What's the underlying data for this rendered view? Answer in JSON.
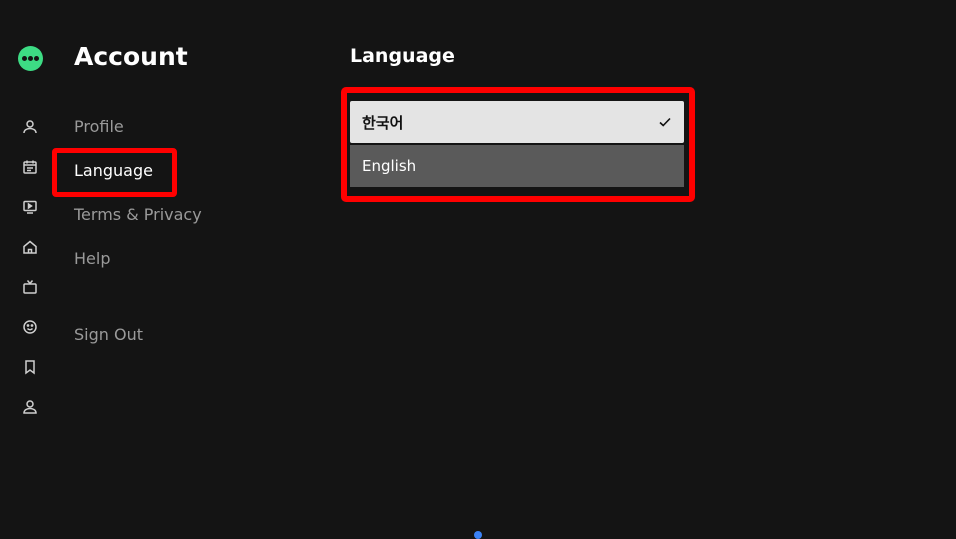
{
  "rail": {
    "logo_icon": "app-logo-icon",
    "icons": [
      "profile-icon",
      "calendar-icon",
      "tv-play-icon",
      "home-icon",
      "live-tv-icon",
      "smiley-icon",
      "bookmark-icon",
      "account-icon"
    ]
  },
  "account": {
    "title": "Account",
    "menu": {
      "profile": "Profile",
      "language": "Language",
      "terms": "Terms & Privacy",
      "help": "Help",
      "signout": "Sign Out"
    }
  },
  "language_panel": {
    "title": "Language",
    "options": [
      {
        "label": "한국어",
        "selected": true
      },
      {
        "label": "English",
        "selected": false
      }
    ]
  },
  "colors": {
    "background": "#141414",
    "logo": "#3ddc84",
    "highlight": "#ff0000",
    "selected_option": "#e4e4e4",
    "option": "#5a5a5a"
  }
}
